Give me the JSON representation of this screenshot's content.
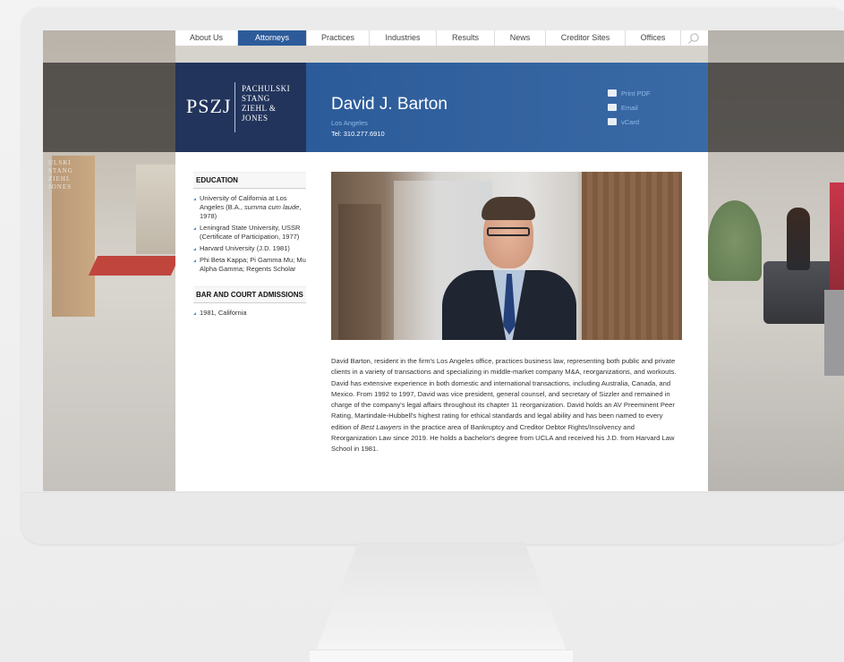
{
  "nav": {
    "items": [
      {
        "label": "About Us",
        "active": false
      },
      {
        "label": "Attorneys",
        "active": true
      },
      {
        "label": "Practices",
        "active": false
      },
      {
        "label": "Industries",
        "active": false
      },
      {
        "label": "Results",
        "active": false
      },
      {
        "label": "News",
        "active": false
      },
      {
        "label": "Creditor Sites",
        "active": false
      },
      {
        "label": "Offices",
        "active": false
      }
    ],
    "search_icon": "search-icon"
  },
  "logo": {
    "mark": "PSZJ",
    "names": [
      "PACHULSKI",
      "STANG",
      "ZIEHL &",
      "JONES"
    ]
  },
  "background_sign": [
    "ULSKI",
    "STANG",
    "ZIEHL",
    "JONES"
  ],
  "attorney": {
    "name": "David J. Barton",
    "office": "Los Angeles",
    "tel": "Tel: 310.277.6910"
  },
  "actions": [
    {
      "label": "Print PDF",
      "icon": "printer-icon"
    },
    {
      "label": "Email",
      "icon": "envelope-icon"
    },
    {
      "label": "vCard",
      "icon": "vcard-icon"
    }
  ],
  "education": {
    "title": "EDUCATION",
    "items": [
      {
        "pre": "University of California at Los Angeles (B.A., ",
        "em": "summa cum laude",
        "post": ", 1978)"
      },
      {
        "pre": "Leningrad State University, USSR (Certificate of Participation, 1977)",
        "em": "",
        "post": ""
      },
      {
        "pre": "Harvard University (J.D. 1981)",
        "em": "",
        "post": ""
      },
      {
        "pre": "Phi Beta Kappa; Pi Gamma Mu; Mu Alpha Gamma; Regents Scholar",
        "em": "",
        "post": ""
      }
    ]
  },
  "admissions": {
    "title": "BAR AND COURT ADMISSIONS",
    "items": [
      "1981, California"
    ]
  },
  "bio": {
    "p1": "David Barton, resident in the firm's Los Angeles office, practices business law, representing both public and private clients in a variety of transactions and specializing in middle-market company M&A, reorganizations, and workouts. David has extensive experience in both domestic and international transactions, including Australia, Canada, and Mexico. From 1992 to 1997, David was vice president, general counsel, and secretary of Sizzler and remained in charge of the company's legal affairs throughout its chapter 11 reorganization. David holds an AV Preeminent Peer Rating, Martindale-Hubbell's highest rating for ethical standards and legal ability and has been named to every edition of ",
    "em": "Best Lawyers",
    "p2": " in the practice area of Bankruptcy and Creditor Debtor Rights/Insolvency and Reorganization Law since 2019. He holds a bachelor's degree from UCLA and received his J.D. from Harvard Law School in 1981."
  },
  "colors": {
    "nav_active": "#2d5b9a",
    "logo_bg": "#22345c",
    "header_blue": "#2c5b99",
    "link_blue": "#8fbbe8",
    "bullet_blue": "#4a8fd0"
  }
}
